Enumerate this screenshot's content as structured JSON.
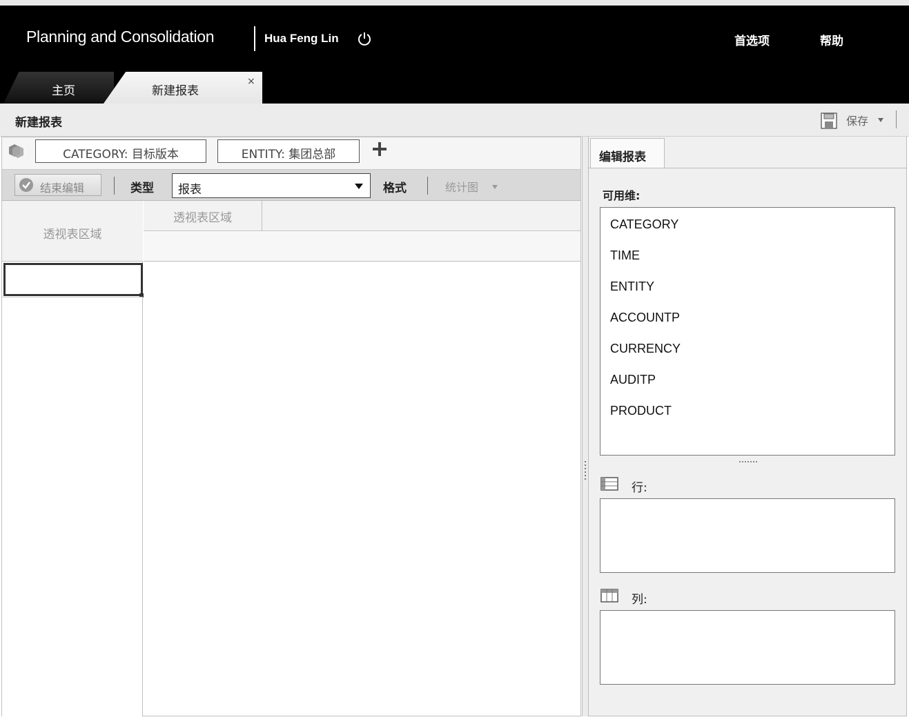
{
  "header": {
    "app_title": "Planning and Consolidation",
    "user_name": "Hua Feng Lin",
    "preferences": "首选项",
    "help": "帮助"
  },
  "tabs": [
    {
      "label": "主页"
    },
    {
      "label": "新建报表",
      "close": "×"
    }
  ],
  "page": {
    "title": "新建报表",
    "save_label": "保存"
  },
  "filters": {
    "category": "CATEGORY: 目标版本",
    "entity": "ENTITY: 集团总部"
  },
  "toolbar": {
    "end_edit": "结束编辑",
    "type_label": "类型",
    "type_value": "报表",
    "format_label": "格式",
    "chart_label": "统计图"
  },
  "grid": {
    "pivot_left": "透视表区域",
    "pivot_top": "透视表区域"
  },
  "right_panel": {
    "tab_label": "编辑报表",
    "available_label": "可用维:",
    "dimensions": [
      "CATEGORY",
      "TIME",
      "ENTITY",
      "ACCOUNTP",
      "CURRENCY",
      "AUDITP",
      "PRODUCT"
    ],
    "rows_label": "行:",
    "columns_label": "列:"
  }
}
